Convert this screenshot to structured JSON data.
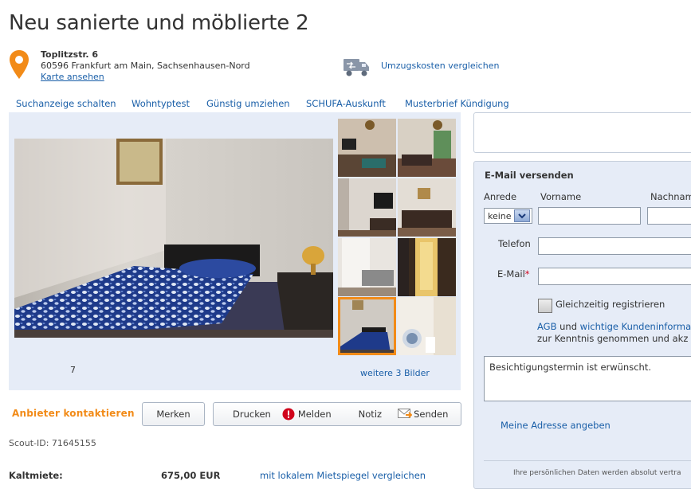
{
  "listing": {
    "title": "Neu sanierte und möblierte 2",
    "address": {
      "street": "Toplitzstr. 6",
      "city_line": "60596 Frankfurt am Main, Sachsenhausen-Nord",
      "map_link": "Karte ansehen"
    },
    "moving_link": "Umzugskosten vergleichen",
    "scout_id": "Scout-ID: 71645155",
    "cold_rent_label": "Kaltmiete:",
    "cold_rent_value": "675,00 EUR",
    "cold_rent_link": "mit lokalem Mietspiegel vergleichen"
  },
  "nav": {
    "links": [
      "Suchanzeige schalten",
      "Wohntyptest",
      "Günstig umziehen",
      "SCHUFA-Auskunft",
      "Musterbrief Kündigung"
    ]
  },
  "gallery": {
    "counter": "7",
    "more_link": "weitere 3 Bilder",
    "selected_index": 6
  },
  "actions": {
    "contact_label": "Anbieter kontaktieren",
    "merken": "Merken",
    "drucken": "Drucken",
    "melden": "Melden",
    "notiz": "Notiz",
    "senden": "Senden"
  },
  "form": {
    "title": "E-Mail versenden",
    "anrede_label": "Anrede",
    "anrede_value": "keine",
    "vorname_label": "Vorname",
    "nachname_label": "Nachnam",
    "telefon_label": "Telefon",
    "email_label": "E-Mail",
    "required_mark": "*",
    "register_label": "Gleichzeitig registrieren",
    "agb_link": "AGB",
    "agb_and": "und",
    "agb_info_link": "wichtige Kundeninforma",
    "agb_line2": "zur Kenntnis genommen und akz",
    "message_value": "Besichtigungstermin ist erwünscht.",
    "address_link": "Meine Adresse angeben",
    "privacy_text": "Ihre persönlichen Daten werden absolut vertra"
  },
  "colors": {
    "link": "#1a5fa8",
    "accent_orange": "#f28b18",
    "panel_bg": "#e6ecf7"
  }
}
